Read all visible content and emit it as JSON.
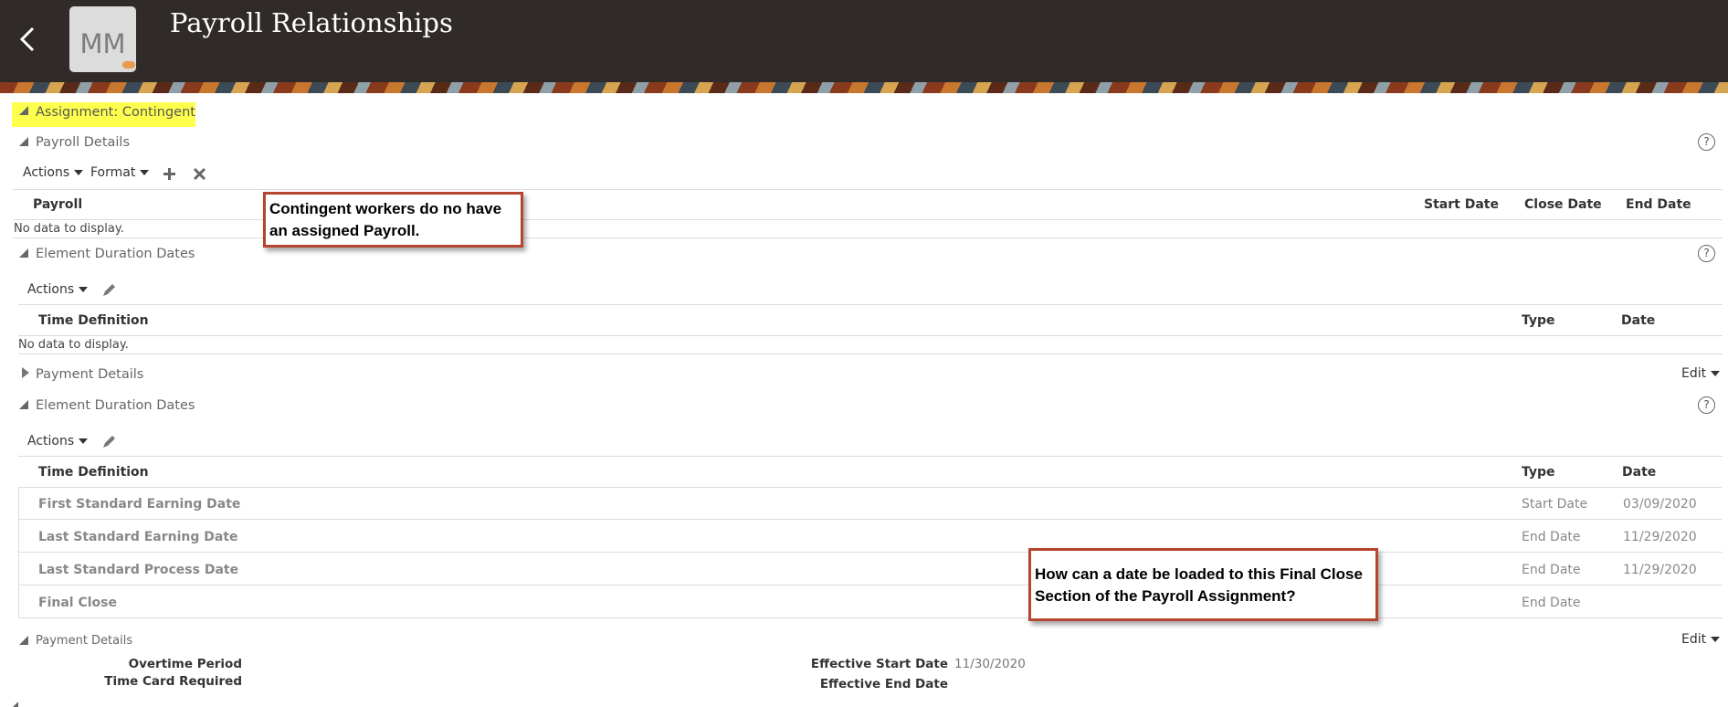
{
  "header": {
    "title": "Payroll Relationships",
    "avatar_initials": "MM"
  },
  "assignment": {
    "label": "Assignment: Contingent"
  },
  "payroll_details": {
    "title": "Payroll Details",
    "actions_label": "Actions",
    "format_label": "Format",
    "columns": [
      "Payroll",
      "Start Date",
      "Close Date",
      "End Date"
    ],
    "empty_text": "No data to display."
  },
  "element_duration_1": {
    "title": "Element Duration Dates",
    "actions_label": "Actions",
    "columns": [
      "Time Definition",
      "Type",
      "Date"
    ],
    "empty_text": "No data to display."
  },
  "payment_details_1": {
    "title": "Payment Details",
    "edit_label": "Edit"
  },
  "element_duration_2": {
    "title": "Element Duration Dates",
    "actions_label": "Actions",
    "columns": [
      "Time Definition",
      "Type",
      "Date"
    ],
    "rows": [
      {
        "definition": "First Standard Earning Date",
        "type": "Start Date",
        "date": "03/09/2020"
      },
      {
        "definition": "Last Standard Earning Date",
        "type": "End Date",
        "date": "11/29/2020"
      },
      {
        "definition": "Last Standard Process Date",
        "type": "End Date",
        "date": "11/29/2020"
      },
      {
        "definition": "Final Close",
        "type": "End Date",
        "date": ""
      }
    ]
  },
  "payment_details_2": {
    "title": "Payment Details",
    "edit_label": "Edit",
    "overtime_period_label": "Overtime Period",
    "time_card_required_label": "Time Card Required",
    "effective_start_label": "Effective Start Date",
    "effective_start_value": "11/30/2020",
    "effective_end_label": "Effective End Date"
  },
  "callouts": {
    "first": "Contingent workers do no have an assigned Payroll.",
    "second": "How can a date be loaded to this Final Close Section of the Payroll Assignment?"
  },
  "help_glyph": "?"
}
